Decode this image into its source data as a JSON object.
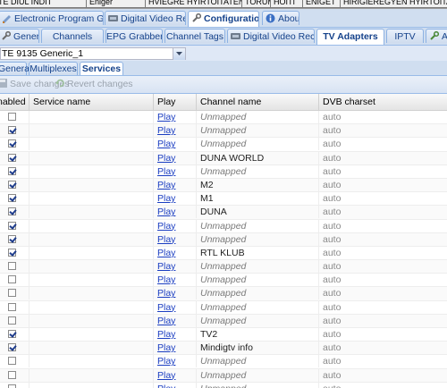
{
  "top_strip": {
    "items": [
      "TE DIUL INDIT",
      "Eniger",
      "HVIEGRE HYIRTOITATEN",
      "TORUMAS",
      "HOITI",
      "ENIGET",
      "HIRIGIEREGYEN HYIRTOITATEN"
    ]
  },
  "main_tabs": [
    {
      "label": "Electronic Program Guide",
      "icon": "epg-icon",
      "active": false
    },
    {
      "label": "Digital Video Recorder",
      "icon": "dvr-icon",
      "active": false
    },
    {
      "label": "Configuration",
      "icon": "wrench-icon",
      "active": true
    },
    {
      "label": "About",
      "icon": "info-icon",
      "active": false
    }
  ],
  "config_tabs": [
    {
      "label": "General",
      "icon": "wrench-icon",
      "active": false
    },
    {
      "label": "Channels",
      "icon": "",
      "active": false
    },
    {
      "label": "EPG Grabber",
      "icon": "",
      "active": false
    },
    {
      "label": "Channel Tags",
      "icon": "",
      "active": false
    },
    {
      "label": "Digital Video Recorder",
      "icon": "dvr-icon",
      "active": false
    },
    {
      "label": "TV Adapters",
      "icon": "",
      "active": true
    },
    {
      "label": "IPTV",
      "icon": "",
      "active": false
    },
    {
      "label": "Au",
      "icon": "wrench-icon",
      "active": false
    }
  ],
  "adapter_select": {
    "value": "TE 9135 Generic_1"
  },
  "sub_tabs": [
    {
      "label": "General",
      "active": false
    },
    {
      "label": "Multiplexes",
      "active": false
    },
    {
      "label": "Services",
      "active": true
    }
  ],
  "toolbar": {
    "save_label": "Save changes",
    "revert_label": "Revert changes"
  },
  "grid": {
    "columns": [
      "Enabled",
      "Service name",
      "Play",
      "Channel name",
      "DVB charset"
    ],
    "rows": [
      {
        "enabled": false,
        "service": "",
        "play": "Play",
        "channel": "Unmapped",
        "charset": "auto"
      },
      {
        "enabled": true,
        "service": "",
        "play": "Play",
        "channel": "Unmapped",
        "charset": "auto"
      },
      {
        "enabled": true,
        "service": "",
        "play": "Play",
        "channel": "Unmapped",
        "charset": "auto"
      },
      {
        "enabled": true,
        "service": "",
        "play": "Play",
        "channel": "DUNA WORLD",
        "charset": "auto"
      },
      {
        "enabled": true,
        "service": "",
        "play": "Play",
        "channel": "Unmapped",
        "charset": "auto"
      },
      {
        "enabled": true,
        "service": "",
        "play": "Play",
        "channel": "M2",
        "charset": "auto"
      },
      {
        "enabled": true,
        "service": "",
        "play": "Play",
        "channel": "M1",
        "charset": "auto"
      },
      {
        "enabled": true,
        "service": "",
        "play": "Play",
        "channel": "DUNA",
        "charset": "auto"
      },
      {
        "enabled": true,
        "service": "",
        "play": "Play",
        "channel": "Unmapped",
        "charset": "auto"
      },
      {
        "enabled": true,
        "service": "",
        "play": "Play",
        "channel": "Unmapped",
        "charset": "auto"
      },
      {
        "enabled": true,
        "service": "",
        "play": "Play",
        "channel": "RTL KLUB",
        "charset": "auto"
      },
      {
        "enabled": false,
        "service": "",
        "play": "Play",
        "channel": "Unmapped",
        "charset": "auto"
      },
      {
        "enabled": false,
        "service": "",
        "play": "Play",
        "channel": "Unmapped",
        "charset": "auto"
      },
      {
        "enabled": false,
        "service": "",
        "play": "Play",
        "channel": "Unmapped",
        "charset": "auto"
      },
      {
        "enabled": false,
        "service": "",
        "play": "Play",
        "channel": "Unmapped",
        "charset": "auto"
      },
      {
        "enabled": false,
        "service": "",
        "play": "Play",
        "channel": "Unmapped",
        "charset": "auto"
      },
      {
        "enabled": true,
        "service": "",
        "play": "Play",
        "channel": "TV2",
        "charset": "auto"
      },
      {
        "enabled": true,
        "service": "",
        "play": "Play",
        "channel": "Mindigtv info",
        "charset": "auto"
      },
      {
        "enabled": false,
        "service": "",
        "play": "Play",
        "channel": "Unmapped",
        "charset": "auto"
      },
      {
        "enabled": false,
        "service": "",
        "play": "Play",
        "channel": "Unmapped",
        "charset": "auto"
      },
      {
        "enabled": false,
        "service": "",
        "play": "Play",
        "channel": "Unmapped",
        "charset": "auto"
      }
    ]
  },
  "colors": {
    "tab_bg": "#d0def0",
    "tab_text": "#15428b",
    "link": "#1a3dc1"
  }
}
